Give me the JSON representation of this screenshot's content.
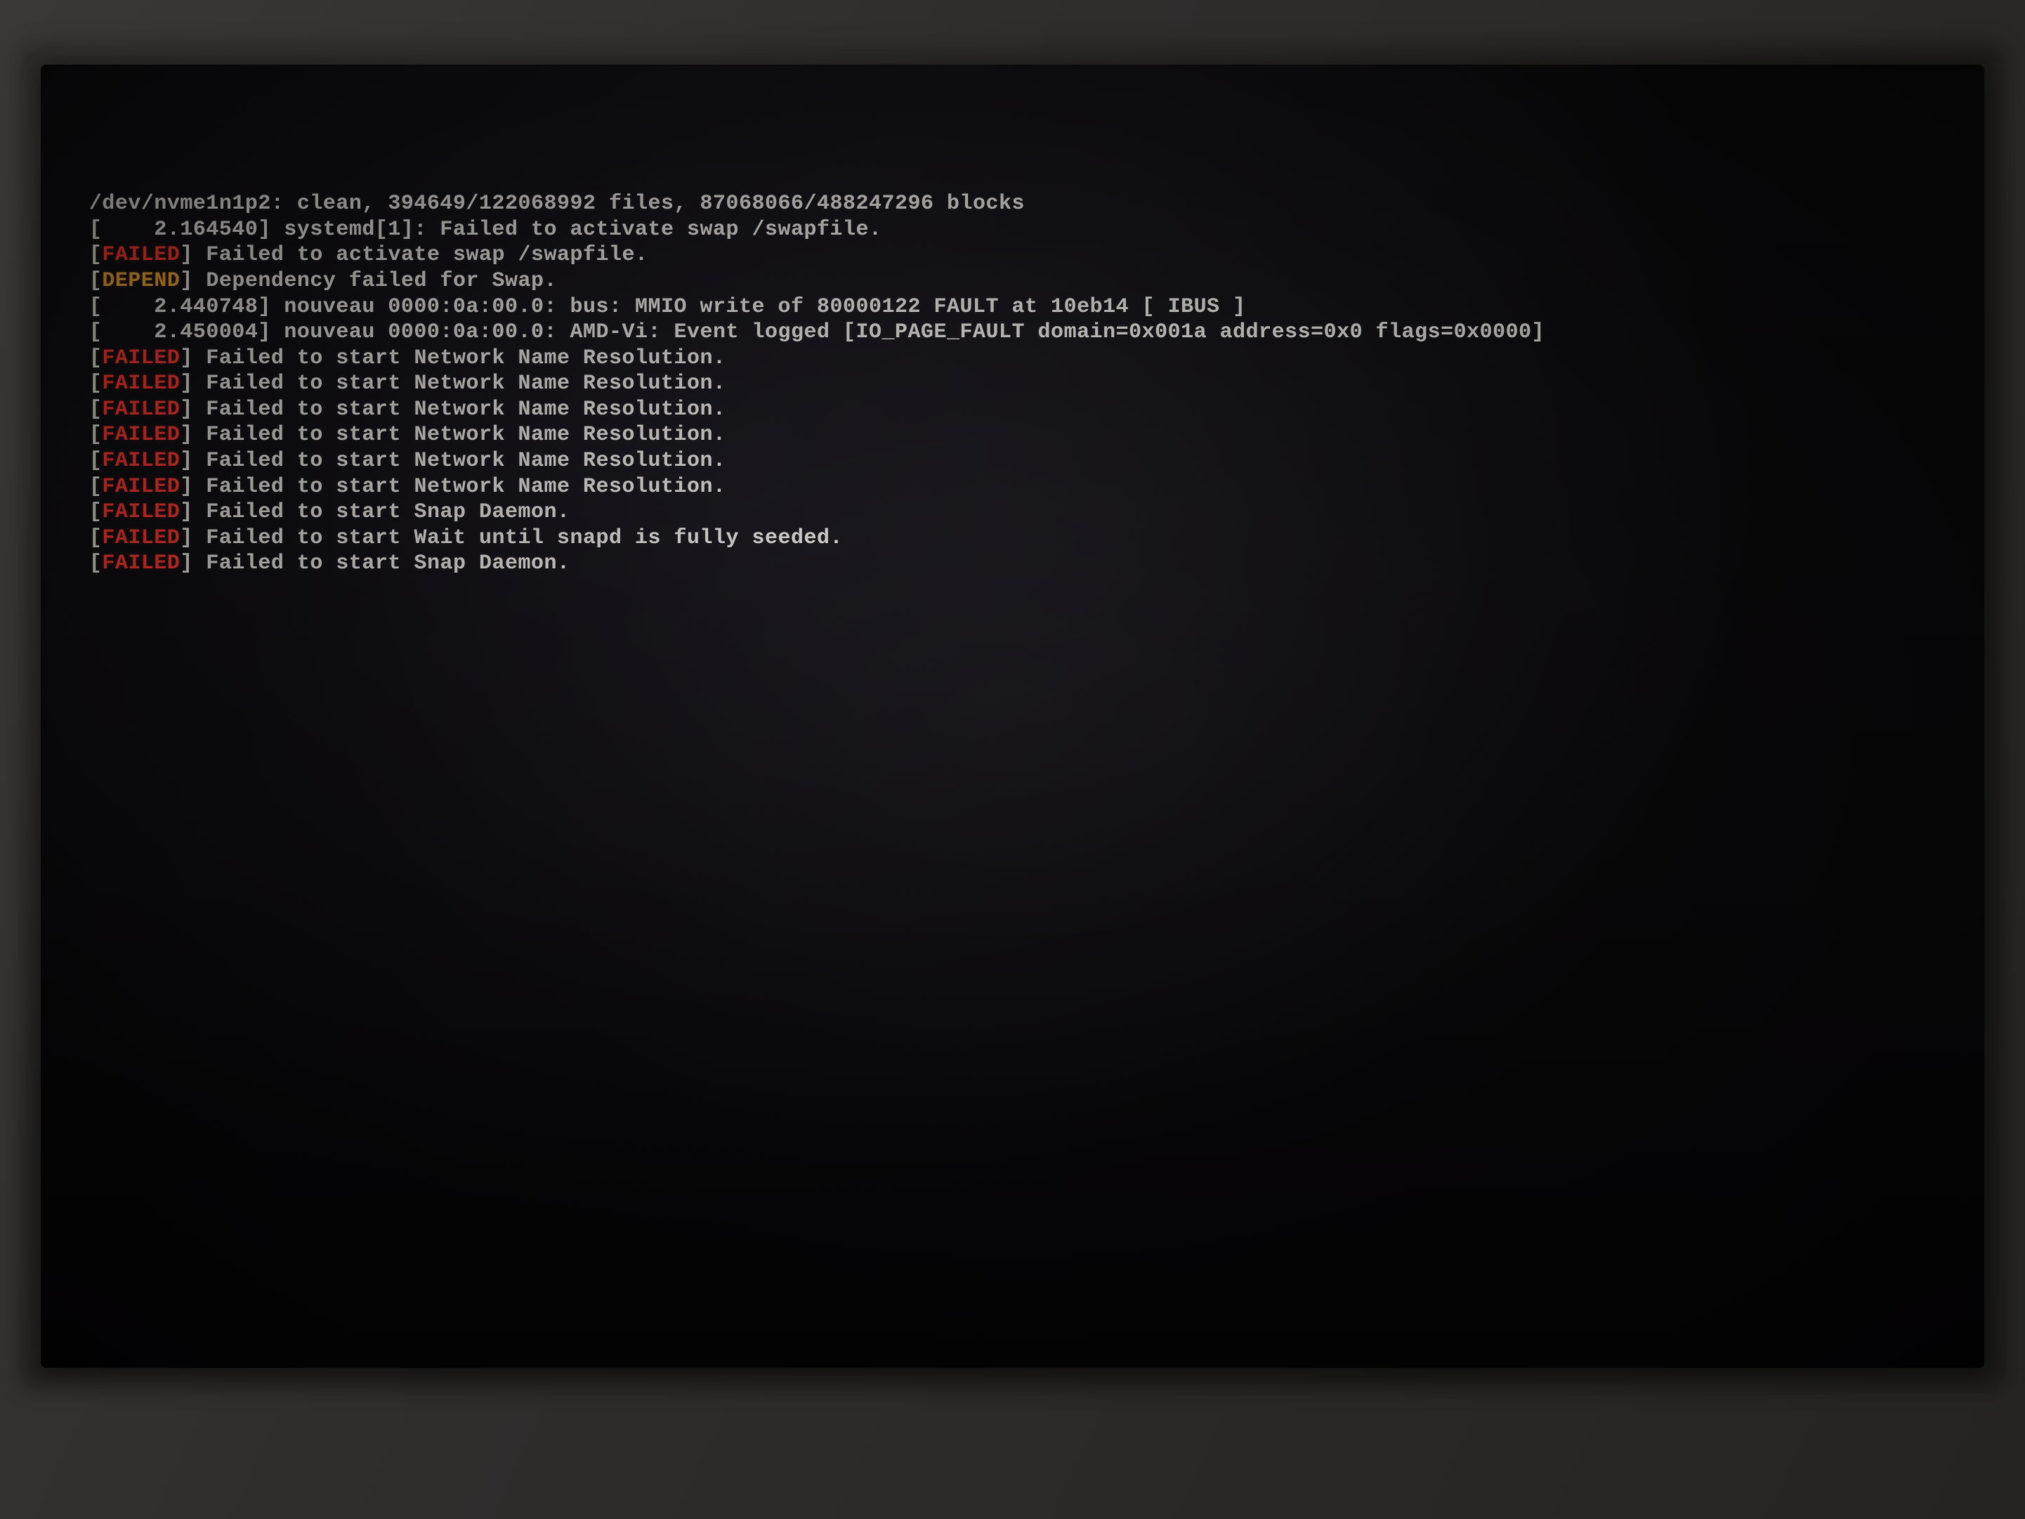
{
  "colors": {
    "failed": "#ff3a32",
    "depend": "#f2a63a",
    "text": "#e3e0dc",
    "bg": "#0a0a0a"
  },
  "boot": {
    "lines": [
      {
        "segments": [
          {
            "text": "/dev/nvme1n1p2: clean, 394649/122068992 files, 87068066/488247296 blocks"
          }
        ]
      },
      {
        "segments": [
          {
            "text": "[    2.164540] systemd[1]: Failed to activate swap /swapfile."
          }
        ]
      },
      {
        "segments": [
          {
            "text": "["
          },
          {
            "text": "FAILED",
            "cls": "tag-failed"
          },
          {
            "text": "] Failed to activate swap /swapfile."
          }
        ]
      },
      {
        "segments": [
          {
            "text": "["
          },
          {
            "text": "DEPEND",
            "cls": "tag-depend"
          },
          {
            "text": "] Dependency failed for Swap."
          }
        ]
      },
      {
        "segments": [
          {
            "text": "[    2.440748] nouveau 0000:0a:00.0: bus: MMIO write of 80000122 FAULT at 10eb14 [ IBUS ]"
          }
        ]
      },
      {
        "segments": [
          {
            "text": "[    2.450004] nouveau 0000:0a:00.0: AMD-Vi: Event logged [IO_PAGE_FAULT domain=0x001a address=0x0 flags=0x0000]"
          }
        ]
      },
      {
        "segments": [
          {
            "text": "["
          },
          {
            "text": "FAILED",
            "cls": "tag-failed"
          },
          {
            "text": "] Failed to start Network Name Resolution."
          }
        ]
      },
      {
        "segments": [
          {
            "text": "["
          },
          {
            "text": "FAILED",
            "cls": "tag-failed"
          },
          {
            "text": "] Failed to start Network Name Resolution."
          }
        ]
      },
      {
        "segments": [
          {
            "text": "["
          },
          {
            "text": "FAILED",
            "cls": "tag-failed"
          },
          {
            "text": "] Failed to start Network Name Resolution."
          }
        ]
      },
      {
        "segments": [
          {
            "text": "["
          },
          {
            "text": "FAILED",
            "cls": "tag-failed"
          },
          {
            "text": "] Failed to start Network Name Resolution."
          }
        ]
      },
      {
        "segments": [
          {
            "text": "["
          },
          {
            "text": "FAILED",
            "cls": "tag-failed"
          },
          {
            "text": "] Failed to start Network Name Resolution."
          }
        ]
      },
      {
        "segments": [
          {
            "text": "["
          },
          {
            "text": "FAILED",
            "cls": "tag-failed"
          },
          {
            "text": "] Failed to start Network Name Resolution."
          }
        ]
      },
      {
        "segments": [
          {
            "text": "["
          },
          {
            "text": "FAILED",
            "cls": "tag-failed"
          },
          {
            "text": "] Failed to start Snap Daemon."
          }
        ]
      },
      {
        "segments": [
          {
            "text": "["
          },
          {
            "text": "FAILED",
            "cls": "tag-failed"
          },
          {
            "text": "] Failed to start Wait until snapd is fully seeded."
          }
        ]
      },
      {
        "segments": [
          {
            "text": "["
          },
          {
            "text": "FAILED",
            "cls": "tag-failed"
          },
          {
            "text": "] Failed to start Snap Daemon."
          }
        ]
      }
    ]
  }
}
